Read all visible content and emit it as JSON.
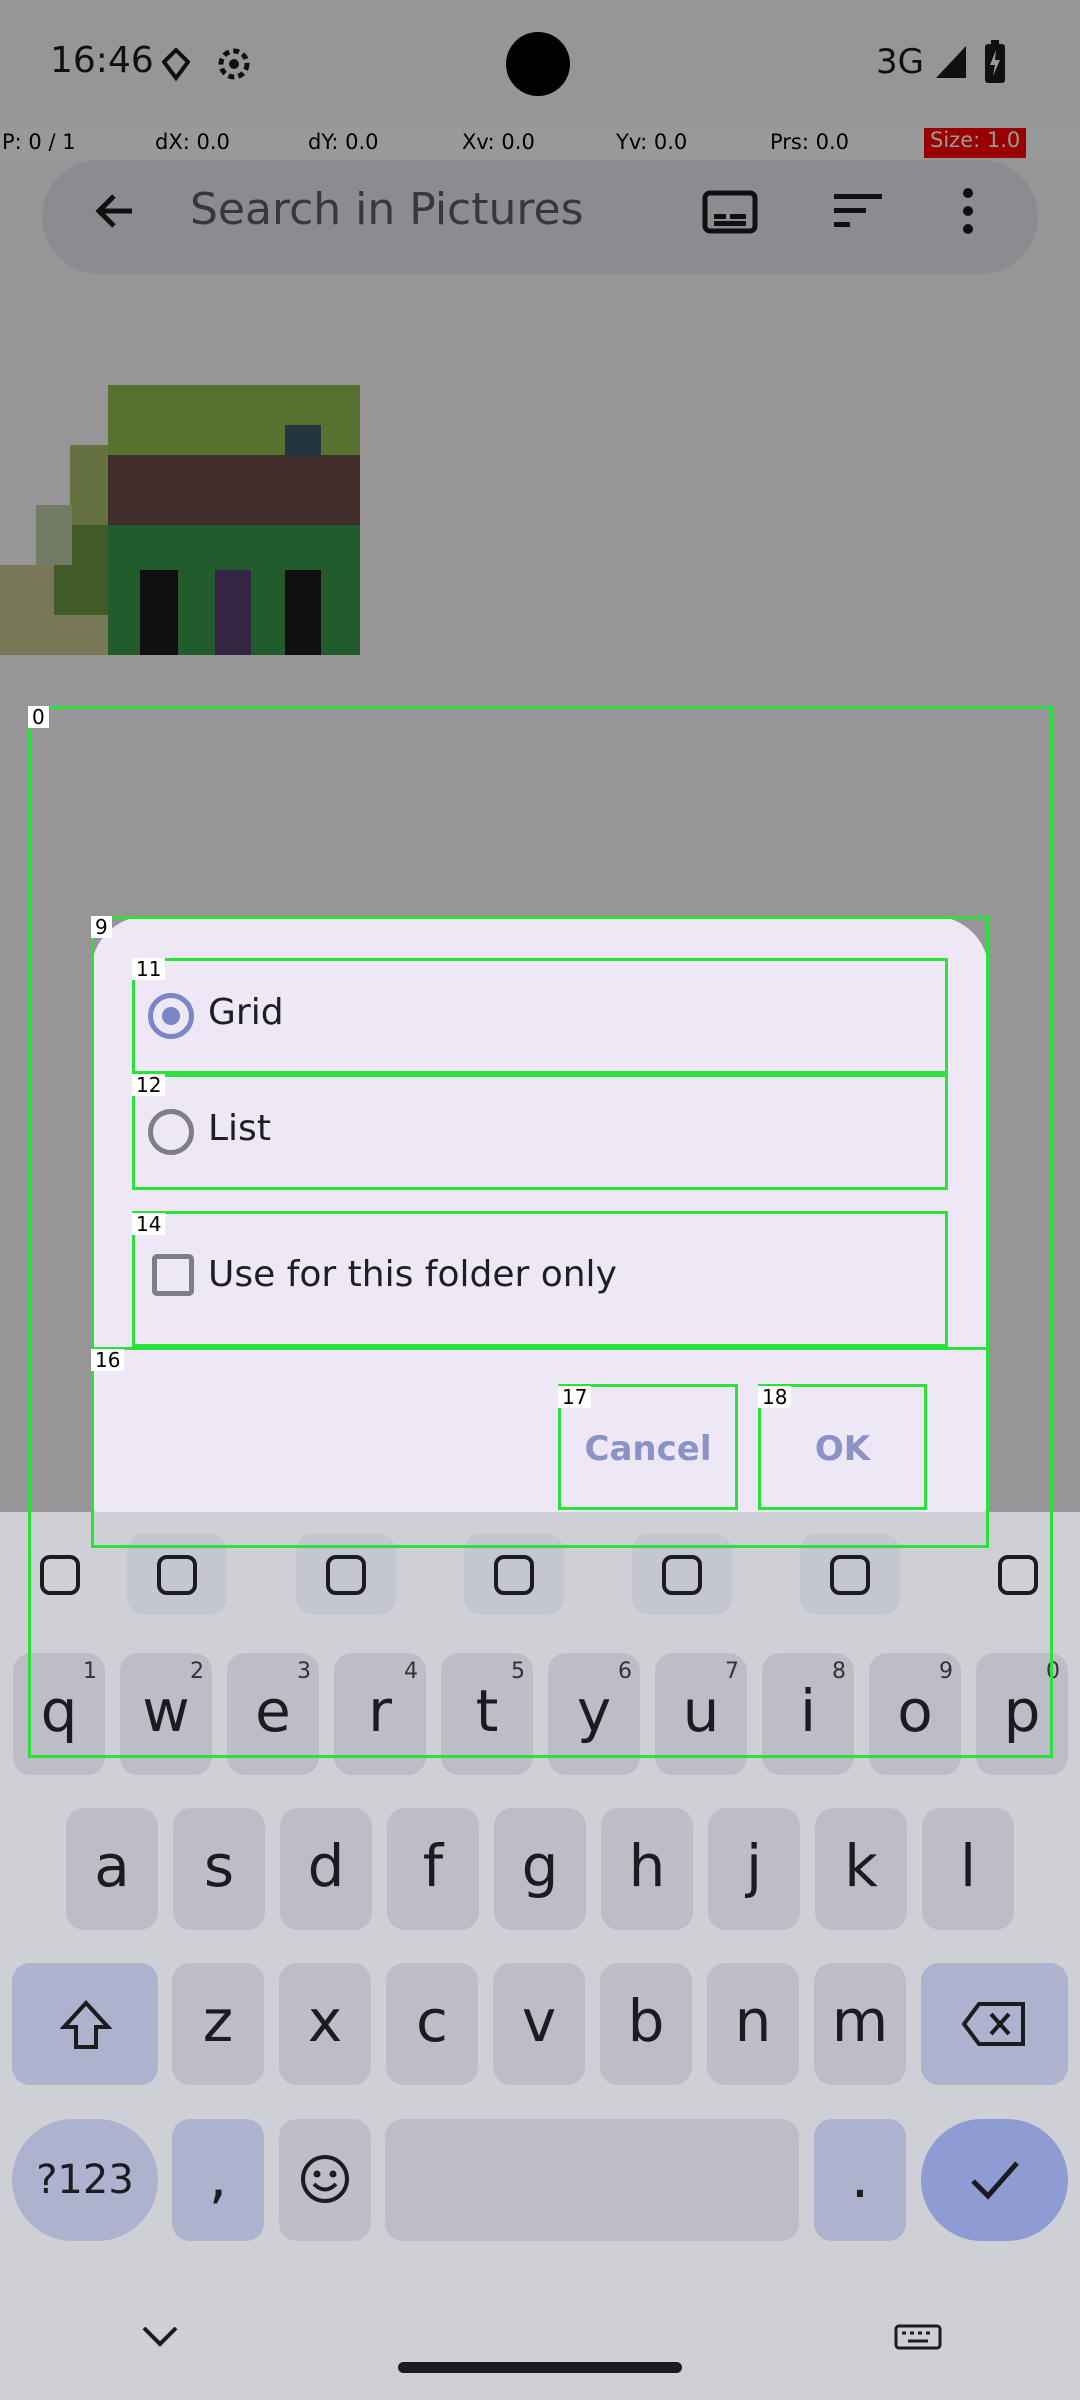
{
  "status_bar": {
    "time": "16:46",
    "network": "3G",
    "icons": [
      "location-icon",
      "settings-gear-icon",
      "signal-icon",
      "battery-charging-icon"
    ]
  },
  "pointer_overlay": {
    "p": "P: 0 / 1",
    "dx": "dX: 0.0",
    "dy": "dY: 0.0",
    "xv": "Xv: 0.0",
    "yv": "Yv: 0.0",
    "prs": "Prs: 0.0",
    "size": "Size: 1.0"
  },
  "toolbar": {
    "search_placeholder": "Search in Pictures",
    "icons": [
      "back-arrow-icon",
      "subtitles-icon",
      "sort-icon",
      "more-vert-icon"
    ]
  },
  "dialog": {
    "options": [
      {
        "label": "Grid",
        "selected": true
      },
      {
        "label": "List",
        "selected": false
      }
    ],
    "checkbox_label": "Use for this folder only",
    "checkbox_checked": false,
    "cancel_label": "Cancel",
    "ok_label": "OK"
  },
  "overlay_labels": {
    "l0": "0",
    "l9": "9",
    "l11": "11",
    "l12": "12",
    "l14": "14",
    "l16": "16",
    "l17": "17",
    "l18": "18"
  },
  "keyboard": {
    "tool_row": [
      "grid-apps-icon",
      "sticker-icon",
      "gif-icon",
      "clipboard-icon",
      "settings-icon",
      "palette-icon",
      "mic-icon"
    ],
    "row1": [
      {
        "key": "q",
        "hint": "1"
      },
      {
        "key": "w",
        "hint": "2"
      },
      {
        "key": "e",
        "hint": "3"
      },
      {
        "key": "r",
        "hint": "4"
      },
      {
        "key": "t",
        "hint": "5"
      },
      {
        "key": "y",
        "hint": "6"
      },
      {
        "key": "u",
        "hint": "7"
      },
      {
        "key": "i",
        "hint": "8"
      },
      {
        "key": "o",
        "hint": "9"
      },
      {
        "key": "p",
        "hint": "0"
      }
    ],
    "row2": [
      "a",
      "s",
      "d",
      "f",
      "g",
      "h",
      "j",
      "k",
      "l"
    ],
    "row3": [
      "z",
      "x",
      "c",
      "v",
      "b",
      "n",
      "m"
    ],
    "symbols_label": "?123",
    "comma_label": ",",
    "period_label": "."
  },
  "colors": {
    "accent": "#7b86c6",
    "overlay_green": "#29e33a",
    "dialog_bg": "#ede7f6"
  }
}
